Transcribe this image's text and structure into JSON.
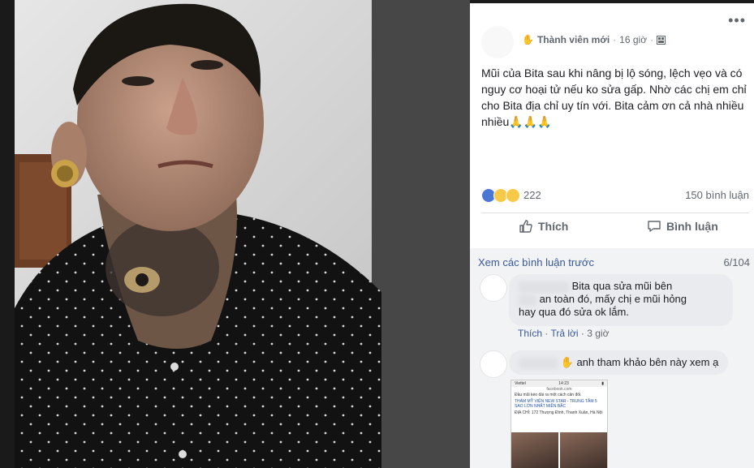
{
  "post": {
    "member_badge": "Thành viên mới",
    "time": "16 giờ",
    "separator": "·",
    "more_icon": "•••",
    "text": "Mũi của Bita sau khi nâng bị lộ sóng, lệch vẹo và có nguy cơ hoại tử nếu ko sửa gấp. Nhờ các chị em chỉ cho Bita địa chỉ uy tín với. Bita cảm ơn cả nhà nhiều nhiều🙏🙏🙏",
    "reaction_count": "222",
    "comment_count": "150 bình luận"
  },
  "actions": {
    "like_label": "Thích",
    "comment_label": "Bình luận"
  },
  "comments_section": {
    "view_previous": "Xem các bình luận trước",
    "page_count": "6/104",
    "comments": [
      {
        "text_line1": "Bita qua sửa mũi bên",
        "text_line2": "an toàn đó, mấy chị e mũi hỏng",
        "text_line3": "hay qua đó sửa ok lắm.",
        "like": "Thích",
        "reply": "Trả lời",
        "time": "3 giờ"
      },
      {
        "text": "anh tham khảo bên này xem ạ"
      }
    ],
    "attachment": {
      "carrier": "Viettel",
      "clock": "14:23",
      "url": "facebook.com",
      "line1": "Đầu mũi kéo dài ra một cách cân đối.",
      "line2": "THẨM MỸ VIỆN NEW STAR - TRUNG TÂM 5 SAO LỚN NHẤT MIỀN BẮC",
      "line3": "ĐỊA CHỈ: 172 Thượng Đình, Thanh Xuân, Hà Nội"
    }
  },
  "colors": {
    "link": "#385898",
    "like_blue": "#4a76d4",
    "bubble": "#e9ebee"
  }
}
